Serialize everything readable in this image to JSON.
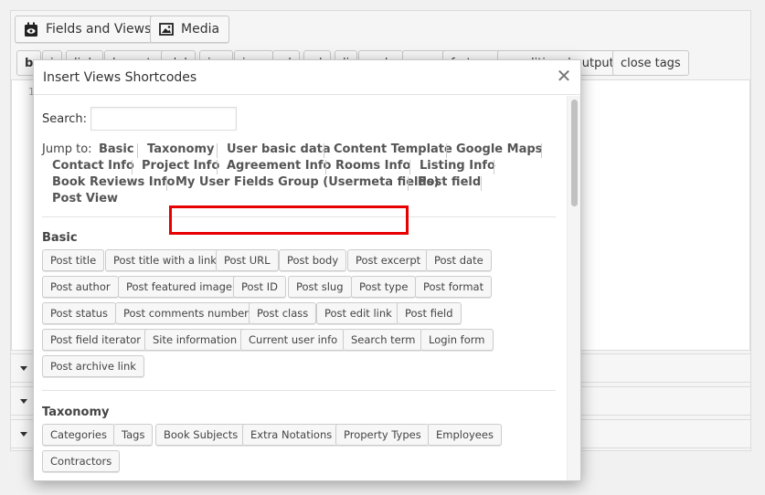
{
  "toolbar": {
    "fields_views_label": "Fields and Views",
    "media_label": "Media",
    "quicktags": [
      "b",
      "i",
      "link",
      "b-quote",
      "del",
      "ins",
      "img",
      "ul",
      "ol",
      "li",
      "code",
      "more",
      "fn-tags",
      "conditional output",
      "close tags"
    ],
    "close_tags_label": "close tags"
  },
  "editor": {
    "line_number": "1"
  },
  "dialog": {
    "title": "Insert Views Shortcodes",
    "search_label": "Search:",
    "search_value": "",
    "jump_label": "Jump to:",
    "jump_links": [
      "Basic",
      "Taxonomy",
      "User basic data",
      "Content Template",
      "Google Maps",
      "Contact Info",
      "Project Info",
      "Agreement Info",
      "Rooms Info",
      "Listing Info",
      "Book Reviews Info",
      "My User Fields Group (Usermeta fields)",
      "Post field",
      "Post View"
    ],
    "highlighted_link": "My User Fields Group (Usermeta fields)",
    "highlight_color": "#e60000",
    "sections": [
      {
        "title": "Basic",
        "buttons": [
          "Post title",
          "Post title with a link",
          "Post URL",
          "Post body",
          "Post excerpt",
          "Post date",
          "Post author",
          "Post featured image",
          "Post ID",
          "Post slug",
          "Post type",
          "Post format",
          "Post status",
          "Post comments number",
          "Post class",
          "Post edit link",
          "Post field",
          "Post field iterator",
          "Site information",
          "Current user info",
          "Search term",
          "Login form",
          "Post archive link"
        ]
      },
      {
        "title": "Taxonomy",
        "buttons": [
          "Categories",
          "Tags",
          "Book Subjects",
          "Extra Notations",
          "Property Types",
          "Employees",
          "Contractors"
        ]
      }
    ]
  }
}
